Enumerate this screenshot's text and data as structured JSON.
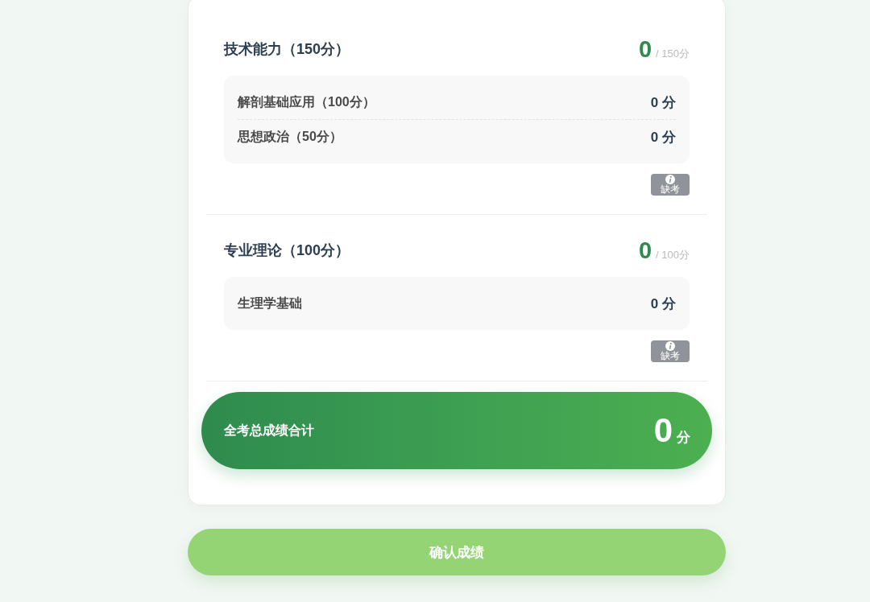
{
  "sections": [
    {
      "title": "技术能力（150分）",
      "score": "0",
      "max": "/ 150分",
      "items": [
        {
          "name": "解剖基础应用（100分）",
          "score": "0 分"
        },
        {
          "name": "思想政治（50分）",
          "score": "0 分"
        }
      ],
      "absent_button": "缺考"
    },
    {
      "title": "专业理论（100分）",
      "score": "0",
      "max": "/ 100分",
      "items": [
        {
          "name": "生理学基础",
          "score": "0 分"
        }
      ],
      "absent_button": "缺考"
    }
  ],
  "total": {
    "label": "全考总成绩合计",
    "value": "0",
    "unit": "分"
  },
  "confirm_button": {
    "label": "确认成绩",
    "disabled": true
  }
}
